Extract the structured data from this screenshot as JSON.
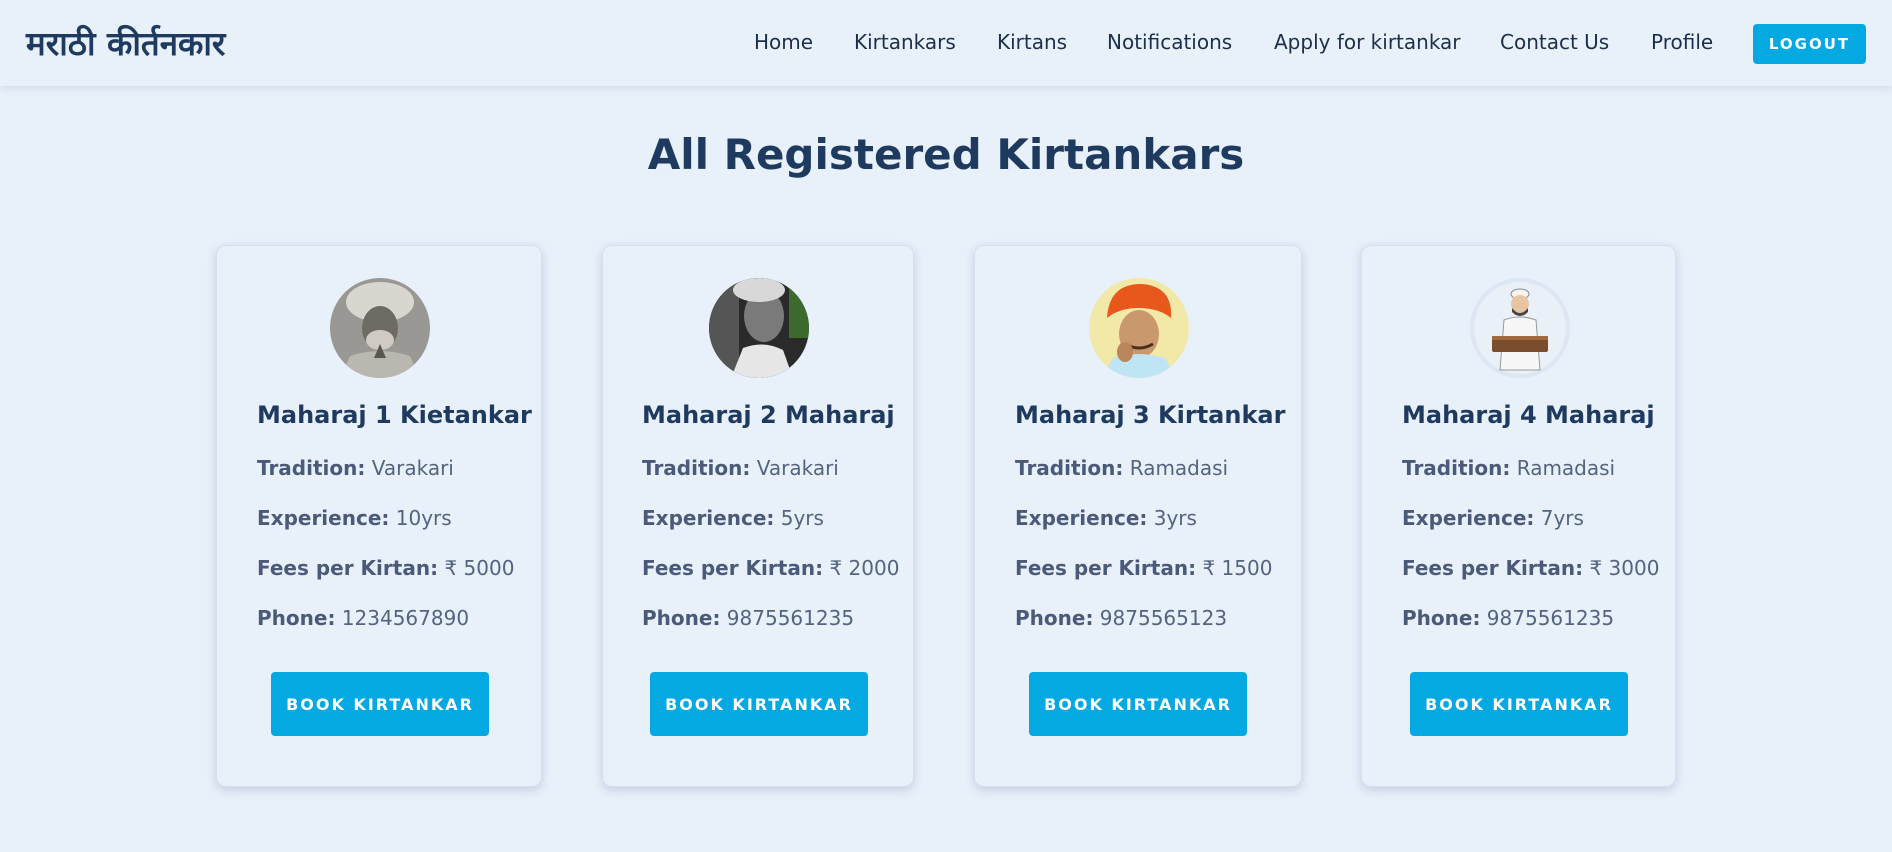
{
  "brand": "मराठी कीर्तनकार",
  "nav": {
    "home": "Home",
    "kirtankars": "Kirtankars",
    "kirtans": "Kirtans",
    "notifications": "Notifications",
    "apply": "Apply for kirtankar",
    "contact": "Contact Us",
    "profile": "Profile",
    "logout": "LOGOUT"
  },
  "page_title": "All Registered Kirtankars",
  "labels": {
    "tradition": "Tradition:",
    "experience": "Experience:",
    "fees": "Fees per Kirtan:",
    "phone": "Phone:",
    "book": "BOOK KIRTANKAR"
  },
  "colors": {
    "accent": "#05a9e2",
    "heading": "#1e3a5f",
    "background": "#e8f0fa"
  },
  "kirtankars": [
    {
      "name": "Maharaj 1 Kietankar",
      "tradition": "Varakari",
      "experience": "10yrs",
      "fees": "₹ 5000",
      "phone": "1234567890",
      "avatar_icon": "elderly-man-turban-photo"
    },
    {
      "name": "Maharaj 2 Maharaj",
      "tradition": "Varakari",
      "experience": "5yrs",
      "fees": "₹ 2000",
      "phone": "9875561235",
      "avatar_icon": "man-bw-photo"
    },
    {
      "name": "Maharaj 3 Kirtankar",
      "tradition": "Ramadasi",
      "experience": "3yrs",
      "fees": "₹ 1500",
      "phone": "9875565123",
      "avatar_icon": "orange-turban-illustration"
    },
    {
      "name": "Maharaj 4 Maharaj",
      "tradition": "Ramadasi",
      "experience": "7yrs",
      "fees": "₹ 3000",
      "phone": "9875561235",
      "avatar_icon": "harmonium-player-illustration"
    }
  ]
}
